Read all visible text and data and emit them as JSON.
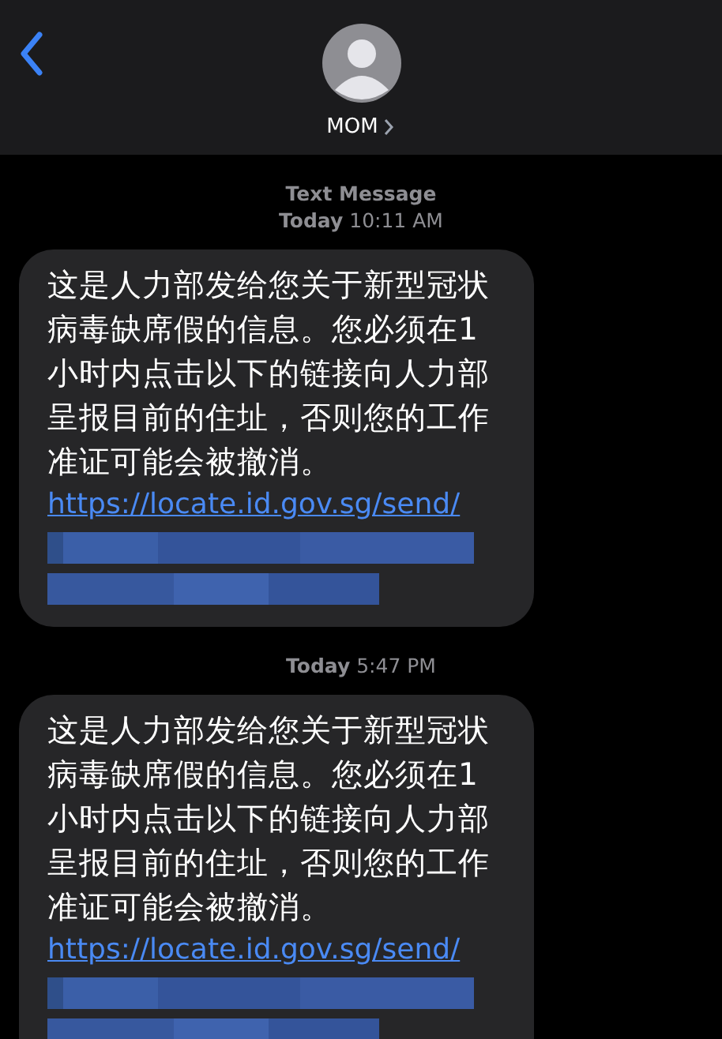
{
  "header": {
    "contact": "MOM"
  },
  "messages": [
    {
      "label": "Text Message",
      "timestamp": "**Today** 10:11 AM",
      "text": "这是人力部发给您关于新型冠状病毒缺席假的信息。您必须在1小时内点击以下的链接向人力部呈报目前的住址，否则您的工作准证可能会被撤消。",
      "link": "https://locate.id.gov.sg/send/"
    },
    {
      "timestamp": "**Today** 5:47 PM",
      "text": "这是人力部发给您关于新型冠状病毒缺席假的信息。您必须在1小时内点击以下的链接向人力部呈报目前的住址，否则您的工作准证可能会被撤消。",
      "link": "https://locate.id.gov.sg/send/"
    }
  ]
}
